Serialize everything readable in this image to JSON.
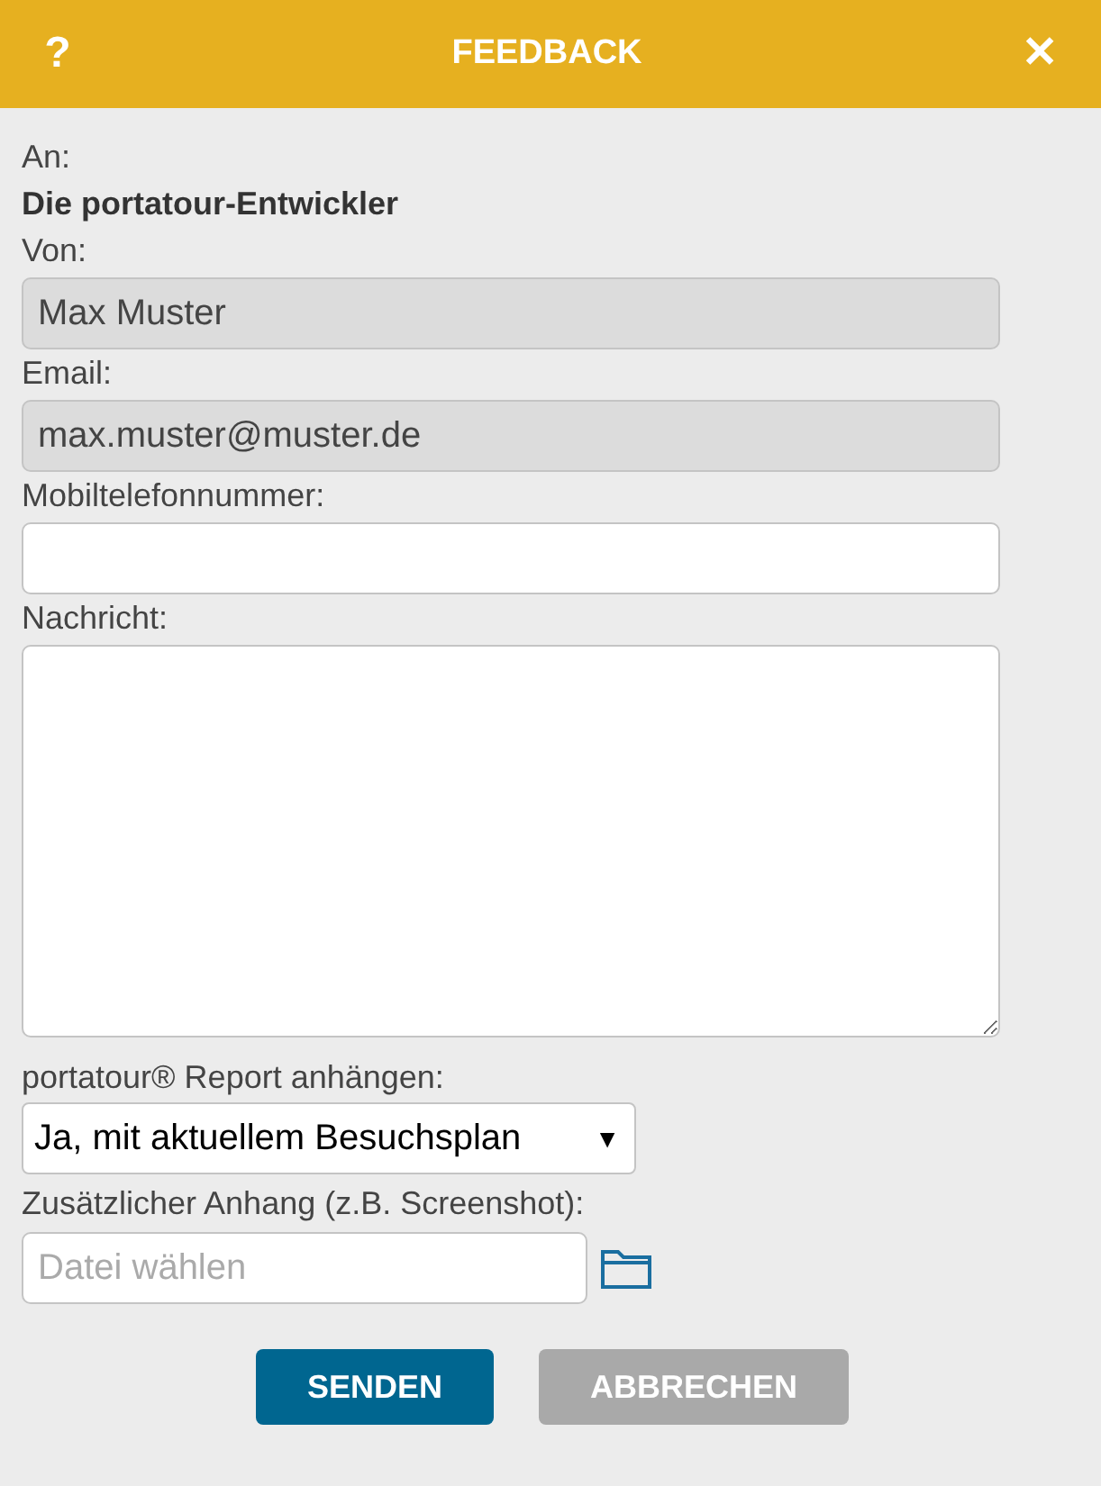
{
  "header": {
    "help": "?",
    "title": "FEEDBACK",
    "close": "✕"
  },
  "recipient": {
    "label": "An:",
    "value": "Die portatour-Entwickler"
  },
  "fields": [
    {
      "label": "Von:",
      "value": "Max Muster",
      "disabled": true
    },
    {
      "label": "Email:",
      "value": "max.muster@muster.de",
      "disabled": true
    },
    {
      "label": "Mobiltelefonnummer:",
      "disabled": false
    }
  ],
  "message": {
    "label": "Nachricht:"
  },
  "report": {
    "label": "portatour® Report anhängen:",
    "value": "Ja, mit aktuellem Besuchsplan",
    "arrow": "▼"
  },
  "attachment": {
    "label": "Zusätzlicher Anhang (z.B. Screenshot):",
    "placeholder": "Datei wählen"
  },
  "buttons": [
    {
      "label": "SENDEN",
      "kind": "primary"
    },
    {
      "label": "ABBRECHEN",
      "kind": "secondary"
    }
  ]
}
